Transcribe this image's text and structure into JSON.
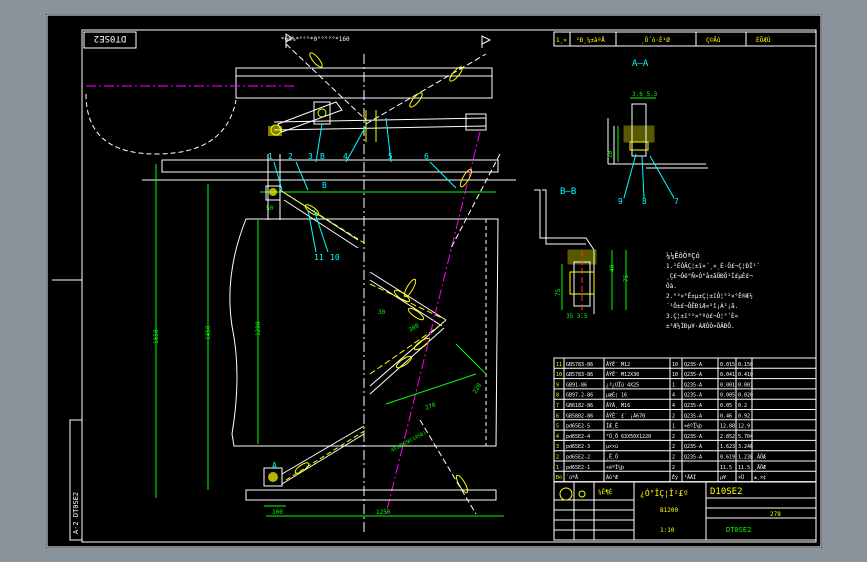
{
  "drawing": {
    "number_mirrored": "DT0SE2",
    "ref_top": "*60%*°°°*0°°°°°*160",
    "vertical_tab": "A-2 DT0SE2",
    "doc_code": "DT0SE2",
    "scale": "1:10",
    "model": "B1200",
    "title_glyph": "¿Ó°ÎÇ¦Î²£º",
    "drawn_by": "¼Ê¶È",
    "weight": "278",
    "code_label": "D10SE2"
  },
  "header_row": [
    "1¸»",
    "²Ð¸¼±àºÅ",
    "¸Ö´ò·È¹Ø",
    "Ç©Ãû",
    "ÈÕÆÚ"
  ],
  "section_labels": {
    "aa": "A—A",
    "bb": "B—B",
    "a_mark": "A",
    "b_mark": "B"
  },
  "part_numbers": [
    "1",
    "2",
    "3",
    "4",
    "5",
    "6",
    "7",
    "8",
    "9",
    "10",
    "11"
  ],
  "dimensions": {
    "d1650": "1650",
    "d1450": "1450",
    "d1200": "1200",
    "d1250": "1250",
    "d100": "100",
    "d50": "50",
    "d300": "300",
    "d270": "270",
    "d220": "220",
    "d30": "30",
    "d2_1250": "4X12W2W(1450)",
    "d20": "20",
    "d3_6_5_3": "3.6 5.3",
    "d40": "40",
    "d75": "75",
    "d20b": "20",
    "d75b": "75",
    "dbb_bottom": "35 3.5"
  },
  "notes": [
    "¼¼ÊõÒªÇó",
    "1.²ÉÓÃÇ¦±ï×´¸×¸É·Ö£¬Ç¦ÐÎ¹´",
    "   ¸Ç£¬Óë°Ñ×Ó°å±ãÖÐÖ¹Í£µÈ£¬",
    "   Óà.",
    "2.°²×°Ê±µ±Ç¦±ïÓ¦°²×°Ë®Æ½",
    "   ´¹Ö±£¬ÔÊÐíÆ«²î¡À²¡ã.",
    "3.Ç¦±ï°²×°ºó£¬Ó¦°´È«",
    "   ±³Æ½ÌÐµ¥·ÀÆÓÒ»ÖÂÐÔ."
  ],
  "bom": [
    [
      "11",
      "GB5783-86",
      "ÂÝË¨ M12",
      "10",
      "Q235-A",
      "0.015",
      "0.150"
    ],
    [
      "10",
      "GB5783-86",
      "ÂÝË¨ M12X30",
      "10",
      "Q235-A",
      "0.041",
      "0.410"
    ],
    [
      "9",
      "GB91-86",
      "¿ª¿ÚÏú 4X25",
      "1",
      "Q235-A",
      "0.001",
      "0.001"
    ],
    [
      "8",
      "GB97.2-86",
      "µæÈ¦ 16",
      "4",
      "Q235-A",
      "0.005",
      "0.020"
    ],
    [
      "7",
      "GB6182-86",
      "ÂÝÄ¸ M16",
      "4",
      "Q235-A",
      "0.05",
      "0.2"
    ],
    [
      "6",
      "GB5802-86",
      "ÂÝË¨ £­´ ¡Á670",
      "2",
      "Q235-A",
      "0.46",
      "0.92"
    ],
    [
      "5",
      "pd65E2-5",
      "ÍÆ¸Ë",
      "1",
      "×éºÏ¼þ",
      "12.88",
      "12.9"
    ],
    [
      "4",
      "pd65E2-4",
      "²Û¸Ö 63X50X1220",
      "2",
      "Q235-A",
      "2.852",
      "5.704"
    ],
    [
      "3",
      "pd65E2-3",
      "µ××ù",
      "2",
      "Q235-A",
      "1.623",
      "3.246"
    ],
    [
      "2",
      "pd65E2-2",
      "¸Ë¸Ö",
      "2",
      "Q235-A",
      "0.619",
      "1.238",
      "¸ÄÖÆ"
    ],
    [
      "1",
      "pd65E2-1",
      "×éºÏ¼þ",
      "2",
      "",
      "11.5",
      "11.5",
      "¸ÄÖÆ"
    ]
  ],
  "bom_header": [
    "Ðò",
    "´úºÅ",
    "Ãû³Æ",
    "Êý",
    "²ÄÁÏ",
    "µ¥",
    "×Ü",
    "±¸×¢"
  ],
  "colors": {
    "background": "#000000",
    "outer": "#8a939c",
    "line_white": "#ffffff",
    "line_green": "#00ff00",
    "line_yellow": "#ffff00",
    "line_magenta": "#ff00ff",
    "line_cyan": "#00ffff",
    "line_blue": "#3f3fff",
    "line_red": "#ff3030"
  }
}
